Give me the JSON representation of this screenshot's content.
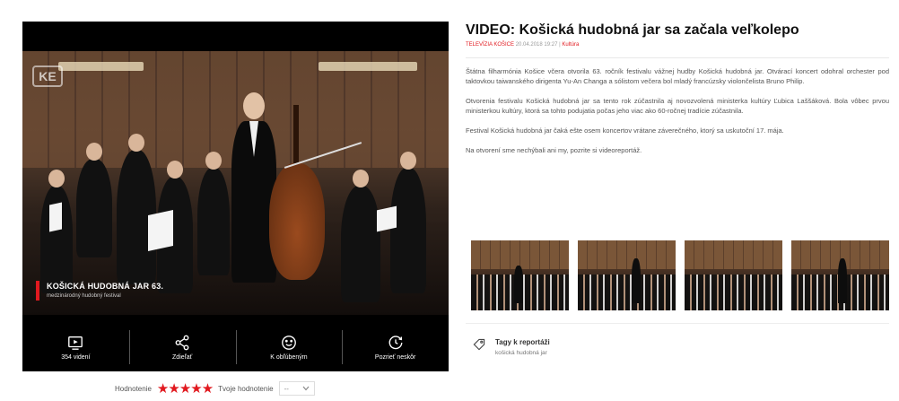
{
  "player": {
    "logo_text": "KE",
    "caption_title": "KOŠICKÁ HUDOBNÁ JAR 63.",
    "caption_subtitle": "medzinárodný hudobný festival",
    "controls": [
      {
        "label": "354 videní",
        "icon": "play-screen-icon"
      },
      {
        "label": "Zdieľať",
        "icon": "share-icon"
      },
      {
        "label": "K obľúbeným",
        "icon": "smiley-icon"
      },
      {
        "label": "Pozrieť neskôr",
        "icon": "clock-refresh-icon"
      }
    ]
  },
  "rating": {
    "label": "Hodnotenie",
    "stars": "★★★★★",
    "value": 5,
    "max": 5,
    "own_label": "Tvoje hodnotenie",
    "own_value": "--"
  },
  "article": {
    "title": "VIDEO: Košická hudobná jar sa začala veľkolepo",
    "source": "TELEVÍZIA KOŠICE",
    "date": "20.04.2018 19:27",
    "category": "Kultúra",
    "paragraphs": [
      "Štátna filharmónia Košice včera otvorila 63. ročník festivalu vážnej hudby Košická hudobná jar. Otvárací koncert odohral orchester pod taktovkou taiwanského dirigenta Yu-An Changa a sólistom večera bol mladý francúzsky violončelista Bruno Philip.",
      "Otvorenia festivalu Košická hudobná jar sa tento rok zúčastnila aj novozvolená ministerka kultúry Ľubica Laššáková. Bola vôbec prvou ministerkou kultúry, ktorá sa tohto podujatia počas jeho viac ako 60-ročnej tradície zúčastnila.",
      "Festival Košická hudobná jar čaká ešte osem koncertov vrátane záverečného, ktorý sa uskutoční 17. mája.",
      "Na otvorení sme nechýbali ani my, pozrite si videoreportáž."
    ]
  },
  "tags": {
    "title": "Tagy k reportáži",
    "items": [
      "košická hudobná jar"
    ]
  },
  "colors": {
    "accent": "#e1191f",
    "player_bg": "#000000"
  }
}
